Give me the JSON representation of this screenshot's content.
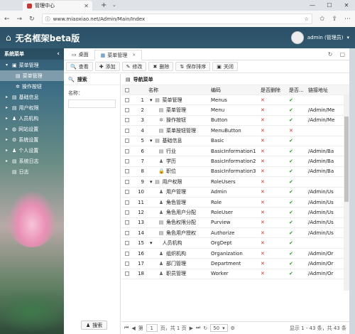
{
  "browser": {
    "tab_title": "管理中心",
    "url": "www.miaoxiao.net/Admin/Main/Index",
    "window_controls": [
      "—",
      "☐",
      "✕"
    ]
  },
  "header": {
    "title": "无名框架beta版",
    "user": "admin (管理员)"
  },
  "sidebar": {
    "title": "系统菜单",
    "items": [
      {
        "label": "菜单管理",
        "arrow": "▾",
        "icon": "▣"
      },
      {
        "label": "菜单管理",
        "icon": "▤",
        "sub": true,
        "selected": true
      },
      {
        "label": "操作按钮",
        "icon": "✲",
        "sub": true
      },
      {
        "label": "基础信息",
        "arrow": "▸",
        "icon": "▤"
      },
      {
        "label": "用户权限",
        "arrow": "▸",
        "icon": "▤"
      },
      {
        "label": "人员机构",
        "arrow": "▸",
        "icon": "♟"
      },
      {
        "label": "网站设置",
        "arrow": "▸",
        "icon": "◍"
      },
      {
        "label": "系统设置",
        "arrow": "▸",
        "icon": "⚙"
      },
      {
        "label": "个人设置",
        "arrow": "▸",
        "icon": "♟"
      },
      {
        "label": "系统日志",
        "arrow": "▸",
        "icon": "▤"
      },
      {
        "label": "日志",
        "arrow": "",
        "icon": "▤"
      }
    ]
  },
  "content_tabs": [
    {
      "label": "桌面",
      "icon": "▭"
    },
    {
      "label": "菜单管理",
      "icon": "▦",
      "active": true
    }
  ],
  "toolbar": {
    "buttons": [
      {
        "label": "查看",
        "icon": "🔍"
      },
      {
        "label": "添加",
        "icon": "✚"
      },
      {
        "label": "修改",
        "icon": "✎"
      },
      {
        "label": "删除",
        "icon": "✖"
      },
      {
        "label": "保存排序",
        "icon": "⇅"
      },
      {
        "label": "关闭",
        "icon": "▣"
      }
    ]
  },
  "search_panel": {
    "title": "搜索",
    "field_label": "名称：",
    "button": "搜索"
  },
  "grid": {
    "title": "导航菜单",
    "columns": [
      "名称",
      "编码",
      "是否删除",
      "是否...",
      "链接地址"
    ],
    "rows": [
      {
        "idx": "1",
        "name": "菜单管理",
        "code": "Menus",
        "del": false,
        "en": true,
        "link": "",
        "level": 0,
        "expand": "▾",
        "icon": "▤"
      },
      {
        "idx": "2",
        "name": "菜单管理",
        "code": "Menu",
        "del": false,
        "en": true,
        "link": "/Admin/Me",
        "level": 1,
        "icon": "▤"
      },
      {
        "idx": "3",
        "name": "操作按钮",
        "code": "Button",
        "del": false,
        "en": true,
        "link": "/Admin/Me",
        "level": 1,
        "icon": "✲"
      },
      {
        "idx": "4",
        "name": "菜单按钮管理",
        "code": "MenuButton",
        "del": false,
        "en": false,
        "link": "",
        "level": 1,
        "icon": "▤"
      },
      {
        "idx": "5",
        "name": "基础信息",
        "code": "Basic",
        "del": false,
        "en": true,
        "link": "",
        "level": 0,
        "expand": "▾",
        "icon": "▤"
      },
      {
        "idx": "6",
        "name": "行业",
        "code": "BasicInformation1",
        "del": false,
        "en": true,
        "link": "/Admin/Ba",
        "level": 1,
        "icon": "▤"
      },
      {
        "idx": "7",
        "name": "学历",
        "code": "BasicInformation2",
        "del": false,
        "en": true,
        "link": "/Admin/Ba",
        "level": 1,
        "icon": "♟"
      },
      {
        "idx": "8",
        "name": "职位",
        "code": "BasicInformation3",
        "del": false,
        "en": true,
        "link": "/Admin/Ba",
        "level": 1,
        "icon": "🔒"
      },
      {
        "idx": "9",
        "name": "用户权限",
        "code": "RoleUsers",
        "del": false,
        "en": true,
        "link": "",
        "level": 0,
        "expand": "▾",
        "icon": "▤"
      },
      {
        "idx": "10",
        "name": "用户管理",
        "code": "Admin",
        "del": false,
        "en": true,
        "link": "/Admin/Us",
        "level": 1,
        "icon": "♟"
      },
      {
        "idx": "11",
        "name": "角色管理",
        "code": "Role",
        "del": false,
        "en": true,
        "link": "/Admin/Us",
        "level": 1,
        "icon": "♟"
      },
      {
        "idx": "12",
        "name": "角色用户分配",
        "code": "RoleUser",
        "del": false,
        "en": true,
        "link": "/Admin/Us",
        "level": 1,
        "icon": "♟"
      },
      {
        "idx": "13",
        "name": "角色权限分配",
        "code": "Purview",
        "del": false,
        "en": true,
        "link": "/Admin/Us",
        "level": 1,
        "icon": "▤"
      },
      {
        "idx": "14",
        "name": "角色用户授权",
        "code": "Authorize",
        "del": false,
        "en": true,
        "link": "/Admin/Us",
        "level": 1,
        "icon": "▤"
      },
      {
        "idx": "15",
        "name": "人员机构",
        "code": "OrgDept",
        "del": false,
        "en": true,
        "link": "",
        "level": 0,
        "expand": "▾",
        "icon": ""
      },
      {
        "idx": "16",
        "name": "组织机构",
        "code": "Organization",
        "del": false,
        "en": true,
        "link": "/Admin/Or",
        "level": 1,
        "icon": "♟"
      },
      {
        "idx": "17",
        "name": "部门管理",
        "code": "Department",
        "del": false,
        "en": true,
        "link": "/Admin/Or",
        "level": 1,
        "icon": "♟"
      },
      {
        "idx": "18",
        "name": "职员管理",
        "code": "Worker",
        "del": false,
        "en": true,
        "link": "/Admin/Or",
        "level": 1,
        "icon": "♟"
      }
    ]
  },
  "pager": {
    "first": "⏮",
    "prev": "◀",
    "page_prefix": "第",
    "page": "1",
    "page_suffix": "页，共 1 页",
    "next": "▶",
    "last": "⏭",
    "refresh": "↻",
    "page_size": "50",
    "settings_icon": "⚙",
    "info": "显示 1 - 43 条，共 43 条"
  },
  "icons": {
    "x": "✕",
    "check": "✔"
  }
}
